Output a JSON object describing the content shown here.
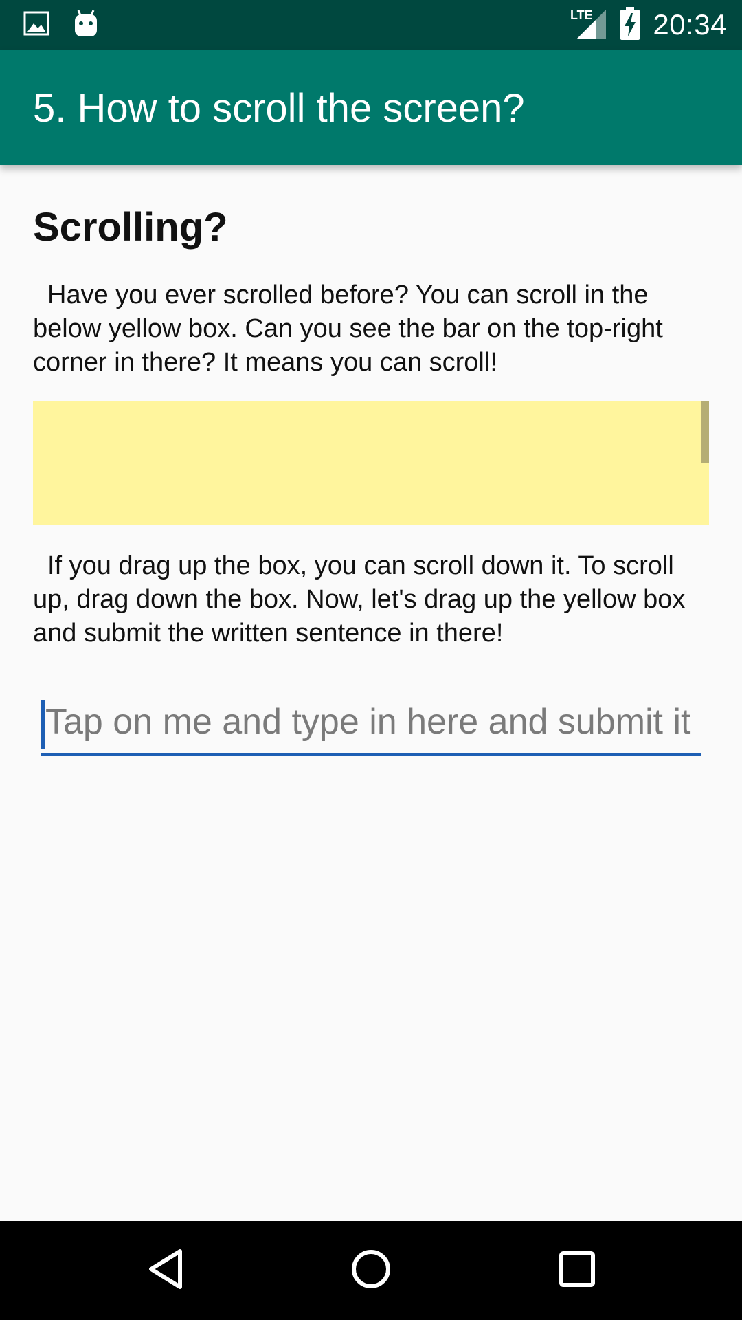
{
  "status_bar": {
    "time": "20:34",
    "network_label": "LTE",
    "icons": [
      "image-notification-icon",
      "android-notification-icon",
      "lte-signal-icon",
      "battery-charging-icon"
    ]
  },
  "app_bar": {
    "title": "5. How to scroll the screen?"
  },
  "content": {
    "heading": "Scrolling?",
    "intro_text": "Have you ever scrolled before? You can scroll in the below yellow box. Can you see the bar on the top-right corner in there? It means you can scroll!",
    "instruction_text": "If you drag up the box, you can scroll down it. To scroll up, drag down the box. Now, let's drag up the yellow box and submit the written sentence in there!",
    "scroll_box_color": "#fff59d",
    "input": {
      "value": "",
      "placeholder": "Tap on me and type in here and submit it"
    }
  },
  "colors": {
    "status_bar": "#00483f",
    "app_bar": "#00796b",
    "accent": "#1e5fb4",
    "background": "#fafafa"
  },
  "nav_bar": {
    "buttons": [
      "back-icon",
      "home-icon",
      "recents-icon"
    ]
  }
}
